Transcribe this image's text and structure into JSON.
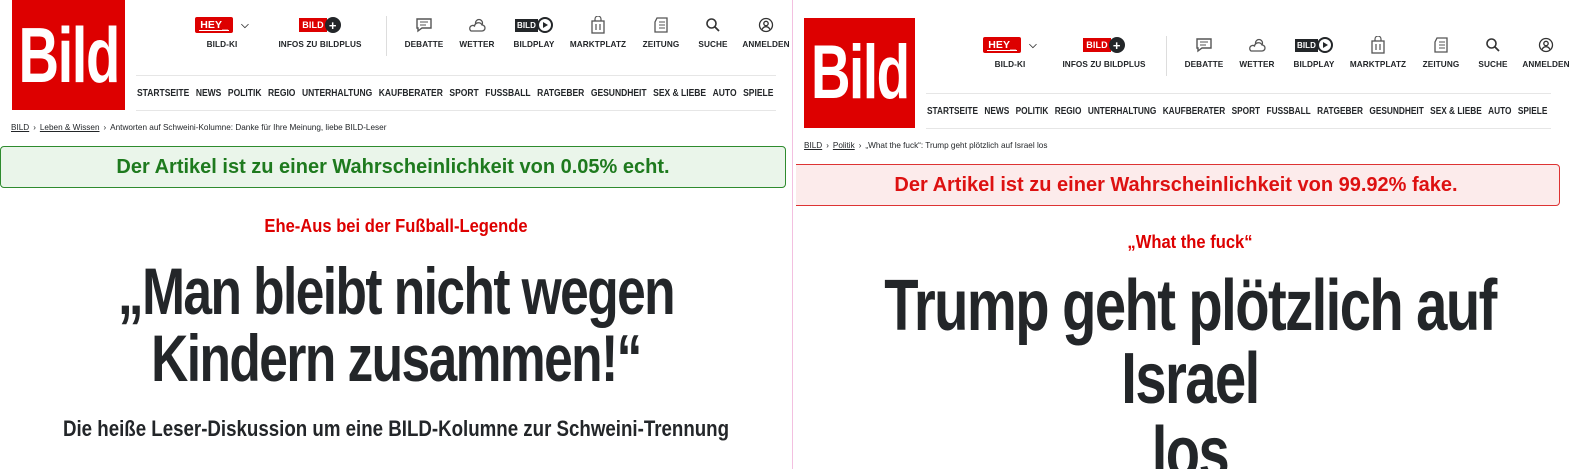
{
  "left": {
    "logo_text": "Bild",
    "nav": {
      "hey_label": "Hey_",
      "bild_ki": "BILD-KI",
      "bildplus_logo": "Bild",
      "infos_bildplus": "INFOS ZU BILDPLUS",
      "debatte": "DEBATTE",
      "wetter": "WETTER",
      "bildplay_logo": "Bild",
      "bildplay": "BILDPLAY",
      "marktplatz": "MARKTPLATZ",
      "zeitung": "ZEITUNG",
      "suche": "SUCHE",
      "anmelden": "ANMELDEN"
    },
    "categories": [
      "STARTSEITE",
      "NEWS",
      "POLITIK",
      "REGIO",
      "UNTERHALTUNG",
      "KAUFBERATER",
      "SPORT",
      "FUSSBALL",
      "RATGEBER",
      "GESUNDHEIT",
      "SEX & LIEBE",
      "AUTO",
      "SPIELE"
    ],
    "breadcrumb": {
      "home": "BILD",
      "section": "Leben & Wissen",
      "current": "Antworten auf Schweini-Kolumne: Danke für Ihre Meinung, liebe BILD-Leser"
    },
    "verdict": "Der Artikel ist zu einer Wahrscheinlichkeit von 0.05% echt.",
    "kicker": "Ehe-Aus bei der Fußball-Legende",
    "headline_line1": "„Man bleibt nicht wegen",
    "headline_line2": "Kindern zusammen!“",
    "subheadline": "Die heiße Leser-Diskussion um eine BILD-Kolumne zur Schweini-Trennung"
  },
  "right": {
    "logo_text": "Bild",
    "nav": {
      "hey_label": "Hey_",
      "bild_ki": "BILD-KI",
      "bildplus_logo": "Bild",
      "infos_bildplus": "INFOS ZU BILDPLUS",
      "debatte": "DEBATTE",
      "wetter": "WETTER",
      "bildplay_logo": "Bild",
      "bildplay": "BILDPLAY",
      "marktplatz": "MARKTPLATZ",
      "zeitung": "ZEITUNG",
      "suche": "SUCHE",
      "anmelden": "ANMELDEN"
    },
    "categories": [
      "STARTSEITE",
      "NEWS",
      "POLITIK",
      "REGIO",
      "UNTERHALTUNG",
      "KAUFBERATER",
      "SPORT",
      "FUSSBALL",
      "RATGEBER",
      "GESUNDHEIT",
      "SEX & LIEBE",
      "AUTO",
      "SPIELE"
    ],
    "breadcrumb": {
      "home": "BILD",
      "section": "Politik",
      "current": "„What the fuck“: Trump geht plötzlich auf Israel los"
    },
    "verdict": "Der Artikel ist zu einer Wahrscheinlichkeit von 99.92% fake.",
    "kicker": "„What the fuck“",
    "headline_line1": "Trump geht plötzlich auf Israel",
    "headline_line2": "los"
  },
  "colors": {
    "brand_red": "#dd0000",
    "real_green": "#1e7a1e",
    "fake_red": "#dd1111",
    "text_dark": "#232629"
  }
}
